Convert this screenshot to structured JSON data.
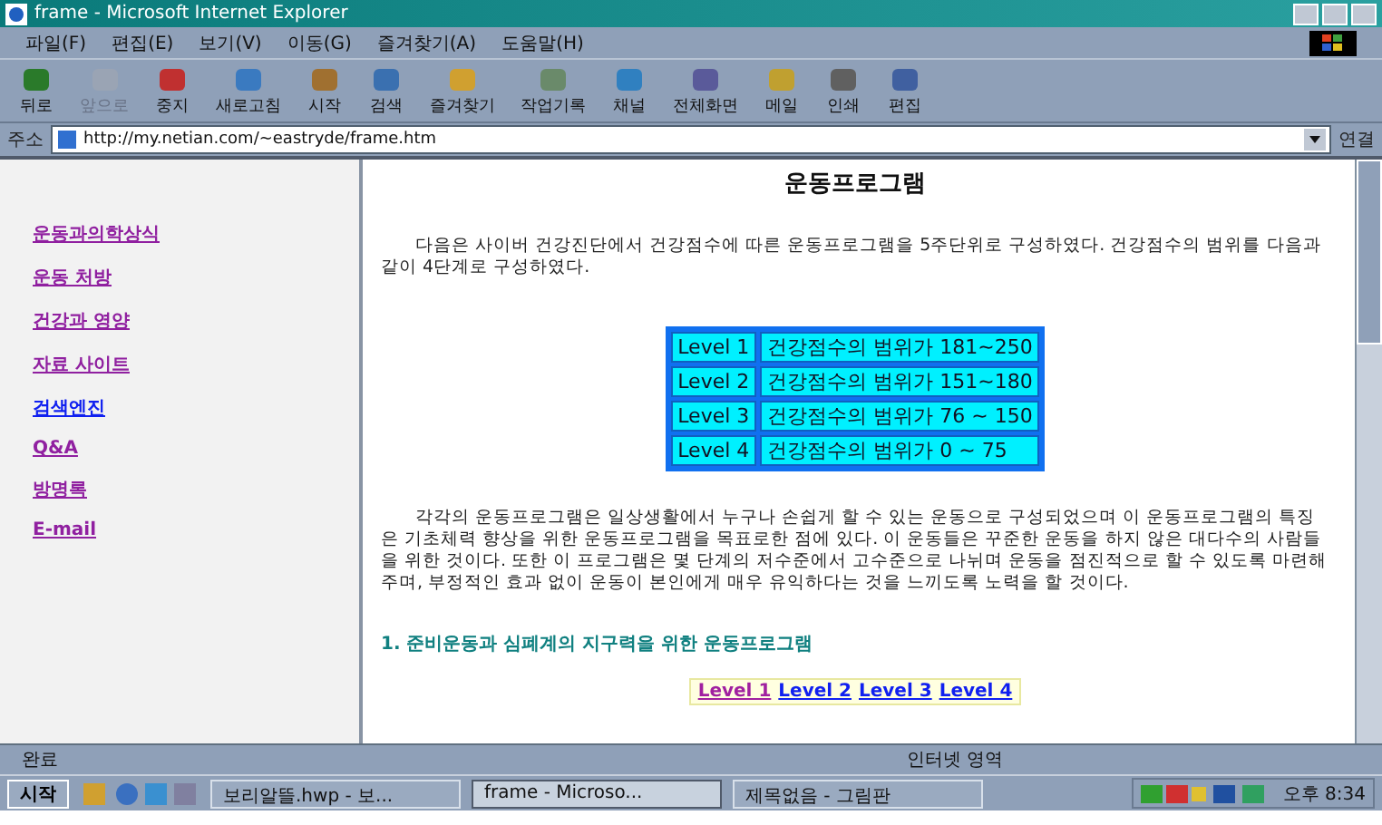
{
  "window": {
    "title": "frame - Microsoft Internet Explorer"
  },
  "menu": [
    "파일(F)",
    "편집(E)",
    "보기(V)",
    "이동(G)",
    "즐겨찾기(A)",
    "도움말(H)"
  ],
  "toolbar": [
    {
      "label": "뒤로",
      "disabled": false
    },
    {
      "label": "앞으로",
      "disabled": true
    },
    {
      "label": "중지",
      "disabled": false
    },
    {
      "label": "새로고침",
      "disabled": false
    },
    {
      "label": "시작",
      "disabled": false
    },
    {
      "label": "검색",
      "disabled": false
    },
    {
      "label": "즐겨찾기",
      "disabled": false
    },
    {
      "label": "작업기록",
      "disabled": false
    },
    {
      "label": "채널",
      "disabled": false
    },
    {
      "label": "전체화면",
      "disabled": false
    },
    {
      "label": "메일",
      "disabled": false
    },
    {
      "label": "인쇄",
      "disabled": false
    },
    {
      "label": "편집",
      "disabled": false
    }
  ],
  "address": {
    "label": "주소",
    "value": "http://my.netian.com/~eastryde/frame.htm",
    "go": "연결"
  },
  "sidebar": {
    "items": [
      {
        "label": "운동과의학상식",
        "visited": true
      },
      {
        "label": "운동 처방",
        "visited": true
      },
      {
        "label": "건강과 영양",
        "visited": true
      },
      {
        "label": "자료 사이트",
        "visited": true
      },
      {
        "label": "검색엔진",
        "visited": false
      },
      {
        "label": "Q&A",
        "visited": true
      },
      {
        "label": "방명록",
        "visited": true
      },
      {
        "label": "E-mail",
        "visited": true
      }
    ]
  },
  "page": {
    "title": "운동프로그램",
    "intro": "다음은 사이버 건강진단에서 건강점수에 따른 운동프로그램을 5주단위로 구성하였다. 건강점수의 범위를 다음과 같이 4단계로 구성하였다.",
    "levels": [
      {
        "level": "Level 1",
        "range": "건강점수의 범위가 181~250"
      },
      {
        "level": "Level 2",
        "range": "건강점수의 범위가 151~180"
      },
      {
        "level": "Level 3",
        "range": "건강점수의 범위가 76 ~ 150"
      },
      {
        "level": "Level 4",
        "range": "건강점수의 범위가 0 ~ 75"
      }
    ],
    "body": "각각의 운동프로그램은 일상생활에서 누구나 손쉽게 할 수 있는 운동으로 구성되었으며 이 운동프로그램의 특징은 기초체력 향상을 위한 운동프로그램을 목표로한 점에 있다. 이 운동들은 꾸준한 운동을 하지 않은 대다수의 사람들을 위한 것이다. 또한 이 프로그램은 몇 단계의 저수준에서 고수준으로 나뉘며 운동을 점진적으로 할 수 있도록 마련해주며, 부정적인 효과 없이 운동이 본인에게 매우 유익하다는 것을 느끼도록 노력을 할 것이다.",
    "section": "1. 준비운동과 심폐계의 지구력을 위한 운동프로그램",
    "links": [
      {
        "label": "Level 1",
        "visited": true
      },
      {
        "label": "Level 2",
        "visited": false
      },
      {
        "label": "Level 3",
        "visited": false
      },
      {
        "label": "Level 4",
        "visited": false
      }
    ]
  },
  "status_bar": {
    "text": "완료",
    "zone": "인터넷 영역"
  },
  "taskbar": {
    "start": "시작",
    "tasks": [
      {
        "label": "보리알뜰.hwp - 보...",
        "selected": false
      },
      {
        "label": "frame - Microso...",
        "selected": true
      },
      {
        "label": "제목없음 - 그림판",
        "selected": false
      }
    ],
    "clock": "오후 8:34"
  }
}
